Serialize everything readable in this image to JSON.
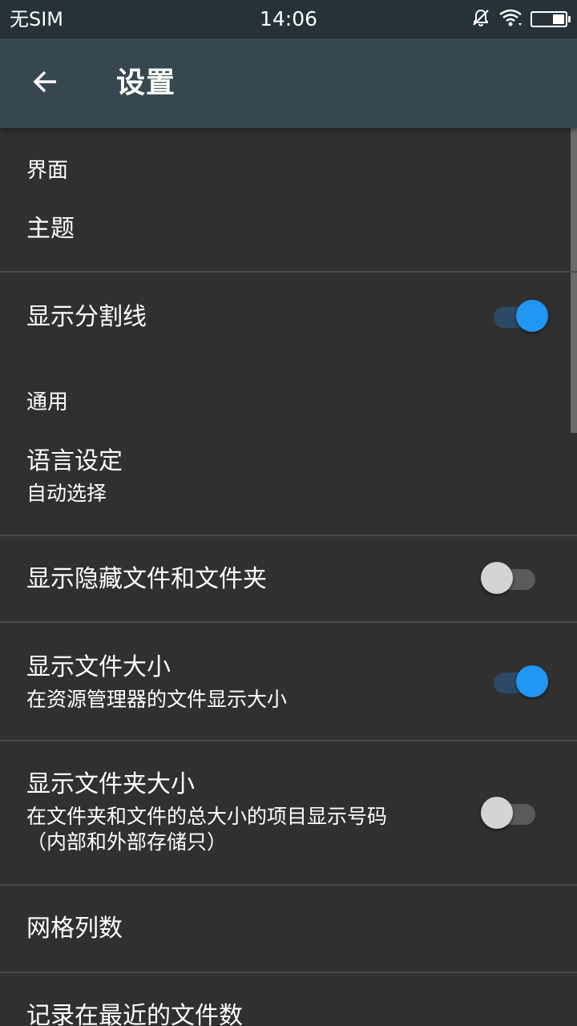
{
  "status_bar": {
    "carrier": "无SIM",
    "time": "14:06",
    "icons": [
      "bell-off-icon",
      "wifi-icon",
      "battery-icon"
    ]
  },
  "app_bar": {
    "back_icon": "arrow-left-icon",
    "title": "设置"
  },
  "sections": {
    "interface_header": "界面",
    "general_header": "通用"
  },
  "prefs": {
    "theme": {
      "title": "主题"
    },
    "show_divider": {
      "title": "显示分割线",
      "checked": true
    },
    "language": {
      "title": "语言设定",
      "summary": "自动选择"
    },
    "show_hidden": {
      "title": "显示隐藏文件和文件夹",
      "checked": false
    },
    "show_file_size": {
      "title": "显示文件大小",
      "summary": "在资源管理器的文件显示大小",
      "checked": true
    },
    "show_folder_size": {
      "title": "显示文件夹大小",
      "summary_line1": "在文件夹和文件的总大小的项目显示号码",
      "summary_line2": "（内部和外部存储只）",
      "checked": false
    },
    "grid_columns": {
      "title": "网格列数"
    },
    "recent_files": {
      "title": "记录在最近的文件数"
    }
  },
  "colors": {
    "background": "#303030",
    "app_bar": "#37474f",
    "status_bar": "#263238",
    "accent": "#2196f3"
  }
}
